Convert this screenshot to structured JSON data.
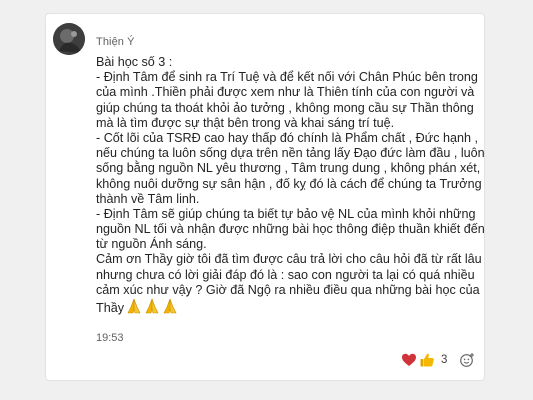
{
  "message": {
    "sender": "Thiện Ý",
    "lines": [
      "Bài học số 3 :",
      "- Định Tâm để sinh ra Trí Tuệ và để kết nối với Chân Phúc bên trong",
      "của mình .Thiền phải được xem như là Thiên tính của con người và",
      "giúp chúng ta thoát khỏi ảo tưởng , không mong cầu sự Thần thông",
      "mà là tìm được sự thật bên trong và khai sáng trí tuệ.",
      "- Cốt lõi của TSRĐ cao hay thấp đó chính là Phẩm chất , Đức hạnh ,",
      "nếu chúng ta luôn sống dựa trên nền tảng lấy Đạo đức làm đầu , luôn",
      "sống bằng nguồn NL yêu thương , Tâm trung dung , không phán xét,",
      "không nuôi dưỡng sự sân hận , đố kỵ đó là cách để chúng ta Trưởng",
      "thành về Tâm linh.",
      "- Định Tâm sẽ giúp chúng ta biết tự bảo vệ NL của mình khỏi những",
      "nguồn NL tối và nhận được những bài học thông điệp thuần khiết đến",
      "từ nguồn Ánh sáng.",
      "Cảm ơn Thầy giờ tôi đã tìm được câu trả lời cho câu hỏi đã từ rất lâu",
      "nhưng chưa có lời giải đáp đó là : sao con người ta lại có quá nhiều",
      "cảm xúc như vậy ? Giờ đã Ngộ ra nhiều điều qua những bài học của",
      "Thầy"
    ],
    "trailing_emojis": [
      "folded-hands-icon",
      "folded-hands-icon",
      "folded-hands-icon"
    ],
    "time": "19:53"
  },
  "reactions": {
    "icons": [
      "heart-icon",
      "thumbs-up-icon"
    ],
    "count": "3",
    "add_icon": "add-reaction-icon"
  },
  "colors": {
    "text": "#242424",
    "meta": "#616161",
    "heart": "#d13438",
    "thumb": "#f5b800",
    "pray": "#f3b400"
  }
}
